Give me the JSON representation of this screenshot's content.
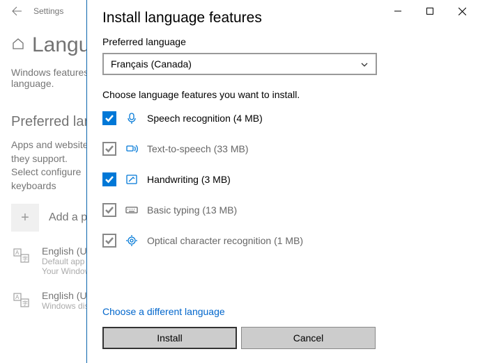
{
  "background": {
    "settings_title": "Settings",
    "heading": "Language",
    "subtext": "Windows features language.",
    "preferred_section": "Preferred languages",
    "apps_text": "Apps and websites they support. Select configure keyboards",
    "add_label": "Add a preferred",
    "lang1_name": "English (United States)",
    "lang1_sub1": "Default app",
    "lang1_sub2": "Your Windows",
    "lang2_name": "English (United Kingdom)",
    "lang2_sub": "Windows display"
  },
  "modal": {
    "title": "Install language features",
    "preferred_label": "Preferred language",
    "selected_language": "Français (Canada)",
    "instructions": "Choose language features you want to install.",
    "features": {
      "speech": "Speech recognition (4 MB)",
      "tts": "Text-to-speech (33 MB)",
      "handwriting": "Handwriting (3 MB)",
      "basic_typing": "Basic typing (13 MB)",
      "ocr": "Optical character recognition (1 MB)"
    },
    "choose_different": "Choose a different language",
    "install_button": "Install",
    "cancel_button": "Cancel"
  }
}
